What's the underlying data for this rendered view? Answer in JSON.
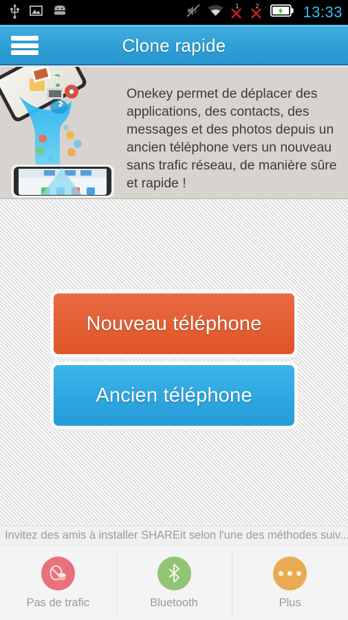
{
  "statusbar": {
    "time": "13:33",
    "time_color": "#37bdef",
    "left_icons": [
      {
        "name": "usb-icon",
        "label": "USB"
      },
      {
        "name": "image-icon",
        "label": "Screenshot"
      },
      {
        "name": "android-icon",
        "label": "Android"
      }
    ],
    "right_icons": [
      {
        "name": "mute-icon",
        "label": "Silent mode"
      },
      {
        "name": "wifi-icon",
        "label": "Wi-Fi"
      },
      {
        "name": "sim1-no-signal-icon",
        "label": "1"
      },
      {
        "name": "sim2-no-signal-icon",
        "label": "2"
      },
      {
        "name": "battery-charging-icon",
        "label": "Charging"
      }
    ],
    "sim1_number": "1",
    "sim2_number": "2"
  },
  "titlebar": {
    "title": "Clone rapide",
    "menu_icon": "hamburger-menu-icon",
    "background_color": "#2f9fd6"
  },
  "banner": {
    "description": "Onekey permet de déplacer des applications, des contacts, des messages et des photos depuis un ancien téléphone vers un nouveau sans trafic réseau, de manière sûre et rapide !",
    "illustration_name": "phone-transfer-illustration",
    "background_color": "#d7d4cf"
  },
  "main": {
    "new_phone_button": "Nouveau téléphone",
    "old_phone_button": "Ancien téléphone",
    "new_phone_color": "#e35f33",
    "old_phone_color": "#2ea6e0"
  },
  "hint": {
    "text": "Invitez des amis à installer SHAREit selon l'une des méthodes suiv..."
  },
  "bottombar": {
    "items": [
      {
        "label": "Pas de trafic",
        "icon": "no-data-traffic-icon",
        "color": "#e8717c"
      },
      {
        "label": "Bluetooth",
        "icon": "bluetooth-icon",
        "color": "#92c475"
      },
      {
        "label": "Plus",
        "icon": "more-dots-icon",
        "color": "#e8ab54"
      }
    ]
  }
}
